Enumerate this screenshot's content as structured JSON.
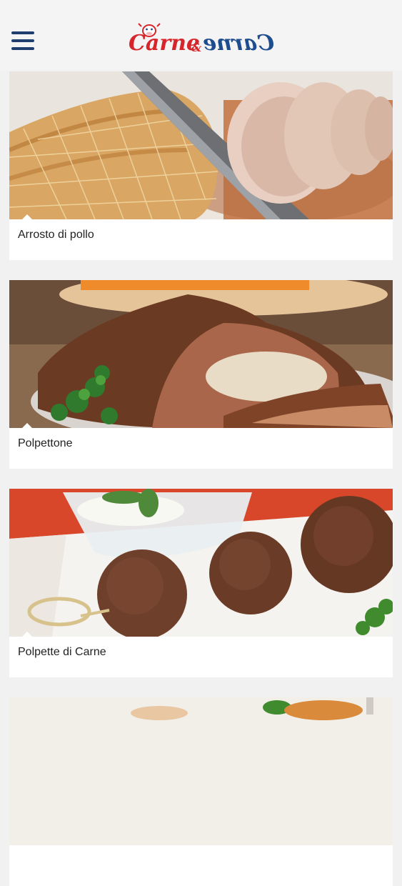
{
  "header": {
    "menu_icon": "hamburger-menu-icon",
    "logo": {
      "left_word": "Carne",
      "ampersand": "&",
      "right_word": "Carne"
    }
  },
  "recipes": [
    {
      "title": "Arrosto di pollo"
    },
    {
      "title": "Polpettone"
    },
    {
      "title": "Polpette di Carne"
    },
    {
      "title": ""
    }
  ],
  "colors": {
    "brand_red": "#d6262b",
    "brand_blue": "#1e4d8f",
    "menu_icon": "#1e3f6e",
    "background": "#f1f1f1",
    "card": "#ffffff"
  }
}
